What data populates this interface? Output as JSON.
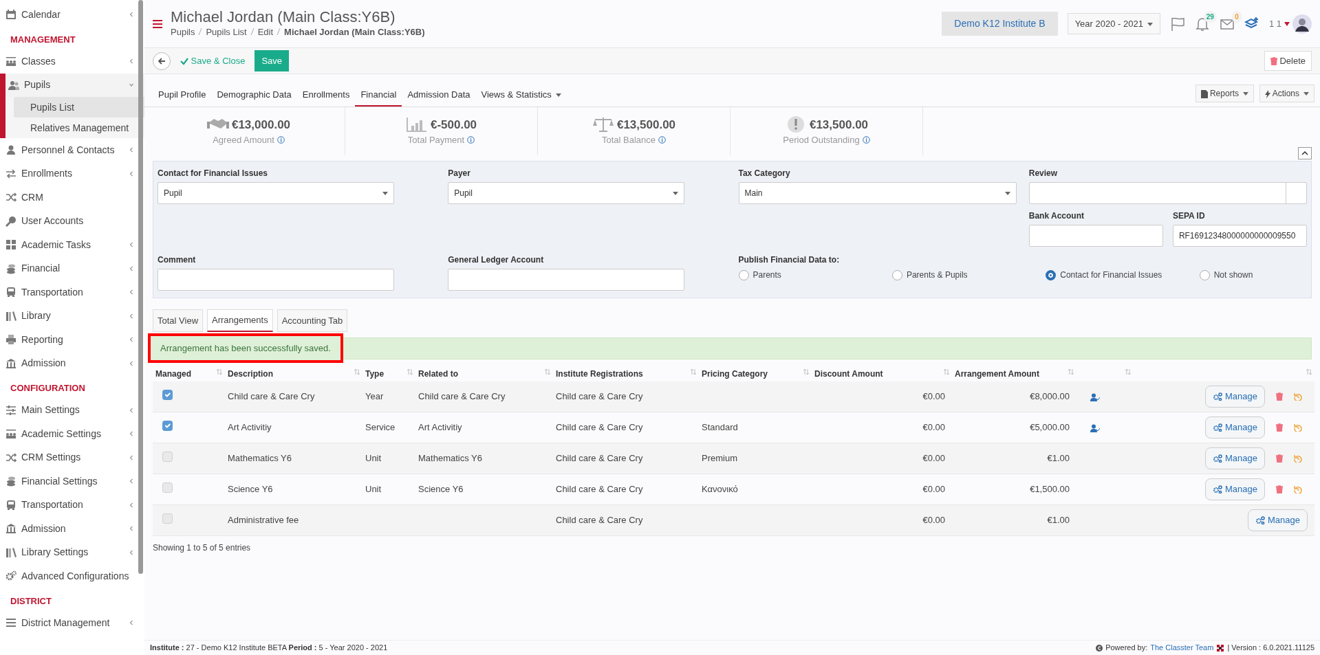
{
  "sidebar": {
    "sections": [
      {
        "items": [
          {
            "label": "Calendar",
            "expanded": false,
            "selected": false
          }
        ]
      },
      {
        "header": "MANAGEMENT",
        "items": [
          {
            "label": "Classes",
            "expanded": false,
            "selected": false
          },
          {
            "label": "Pupils",
            "expanded": true,
            "selected": true,
            "children": [
              {
                "label": "Pupils List",
                "selected": true
              },
              {
                "label": "Relatives Management",
                "selected": false
              }
            ]
          },
          {
            "label": "Personnel & Contacts",
            "expanded": false,
            "selected": false
          },
          {
            "label": "Enrollments",
            "expanded": false,
            "selected": false
          },
          {
            "label": "CRM",
            "selected": false
          },
          {
            "label": "User Accounts",
            "selected": false
          },
          {
            "label": "Academic Tasks",
            "expanded": false,
            "selected": false
          },
          {
            "label": "Financial",
            "expanded": false,
            "selected": false
          },
          {
            "label": "Transportation",
            "expanded": false,
            "selected": false
          },
          {
            "label": "Library",
            "expanded": false,
            "selected": false
          },
          {
            "label": "Reporting",
            "expanded": false,
            "selected": false
          },
          {
            "label": "Admission",
            "expanded": false,
            "selected": false
          }
        ]
      },
      {
        "header": "CONFIGURATION",
        "items": [
          {
            "label": "Main Settings",
            "expanded": false,
            "selected": false
          },
          {
            "label": "Academic Settings",
            "expanded": false,
            "selected": false
          },
          {
            "label": "CRM Settings",
            "expanded": false,
            "selected": false
          },
          {
            "label": "Financial Settings",
            "expanded": false,
            "selected": false
          },
          {
            "label": "Transportation",
            "expanded": false,
            "selected": false
          },
          {
            "label": "Admission",
            "expanded": false,
            "selected": false
          },
          {
            "label": "Library Settings",
            "expanded": false,
            "selected": false
          },
          {
            "label": "Advanced Configurations",
            "selected": false
          }
        ]
      },
      {
        "header": "DISTRICT",
        "items": [
          {
            "label": "District Management",
            "expanded": false,
            "selected": false
          }
        ]
      }
    ]
  },
  "header": {
    "title": "Michael Jordan (Main Class:Y6B)",
    "breadcrumbs": [
      "Pupils",
      "Pupils List",
      "Edit",
      "Michael Jordan (Main Class:Y6B)"
    ],
    "institute": "Demo K12 Institute B",
    "year": "Year 2020 - 2021",
    "notifications": "29",
    "messages": "0",
    "user": "1 1"
  },
  "toolbar": {
    "save_close": "Save & Close",
    "save": "Save",
    "delete": "Delete"
  },
  "tabs": [
    {
      "label": "Pupil Profile",
      "selected": false
    },
    {
      "label": "Demographic Data",
      "selected": false
    },
    {
      "label": "Enrollments",
      "selected": false
    },
    {
      "label": "Financial",
      "selected": true
    },
    {
      "label": "Admission Data",
      "selected": false
    },
    {
      "label": "Views & Statistics",
      "selected": false,
      "dropdown": true
    }
  ],
  "tab_actions": [
    "Reports",
    "Actions"
  ],
  "summary": [
    {
      "amount": "€13,000.00",
      "label": "Agreed Amount"
    },
    {
      "amount": "€-500.00",
      "label": "Total Payment"
    },
    {
      "amount": "€13,500.00",
      "label": "Total Balance"
    },
    {
      "amount": "€13,500.00",
      "label": "Period Outstanding"
    }
  ],
  "form": {
    "contact": {
      "label": "Contact for Financial Issues",
      "value": "Pupil"
    },
    "payer": {
      "label": "Payer",
      "value": "Pupil"
    },
    "tax_category": {
      "label": "Tax Category",
      "value": "Main"
    },
    "review": {
      "label": "Review"
    },
    "bank_account": {
      "label": "Bank Account"
    },
    "sepa_id": {
      "label": "SEPA ID",
      "value": "RF16912348000000000009550"
    },
    "comment": {
      "label": "Comment"
    },
    "ledger": {
      "label": "General Ledger Account"
    },
    "publish": {
      "label": "Publish Financial Data to:",
      "options": [
        {
          "label": "Parents",
          "selected": false
        },
        {
          "label": "Parents & Pupils",
          "selected": false
        },
        {
          "label": "Contact for Financial Issues",
          "selected": true
        },
        {
          "label": "Not shown",
          "selected": false
        }
      ]
    }
  },
  "subtabs": [
    {
      "label": "Total View",
      "selected": false
    },
    {
      "label": "Arrangements",
      "selected": true
    },
    {
      "label": "Accounting Tab",
      "selected": false
    }
  ],
  "alert": "Arrangement has been successfully saved.",
  "table": {
    "columns": [
      "Managed",
      "Description",
      "Type",
      "Related to",
      "Institute Registrations",
      "Pricing Category",
      "Discount Amount",
      "Arrangement Amount"
    ],
    "rows": [
      {
        "checked": true,
        "disabled": false,
        "description": "Child care & Care Cry",
        "type": "Year",
        "related_to": "Child care & Care Cry",
        "registrations": "Child care & Care Cry",
        "discount": "€0.00",
        "amount": "€8,000.00",
        "manage": "Manage",
        "deletable": true
      },
      {
        "checked": true,
        "disabled": false,
        "description": "Art Activitiy",
        "type": "Service",
        "related_to": "Art Activitiy",
        "registrations": "Child care & Care Cry",
        "pricing": "Standard",
        "discount": "€0.00",
        "amount": "€5,000.00",
        "manage": "Manage",
        "deletable": true
      },
      {
        "checked": false,
        "disabled": true,
        "description": "Mathematics Y6",
        "type": "Unit",
        "related_to": "Mathematics Y6",
        "registrations": "Child care & Care Cry",
        "pricing": "Premium",
        "discount": "€0.00",
        "amount": "€1.00",
        "manage": "Manage",
        "deletable": true
      },
      {
        "checked": false,
        "disabled": true,
        "description": "Science Y6",
        "type": "Unit",
        "related_to": "Science Y6",
        "registrations": "Child care & Care Cry",
        "pricing": "Κανονικό",
        "discount": "€0.00",
        "amount": "€1,500.00",
        "manage": "Manage",
        "deletable": true
      },
      {
        "checked": false,
        "disabled": true,
        "description": "Administrative fee",
        "registrations": "Child care & Care Cry",
        "discount": "€0.00",
        "amount": "€1.00",
        "manage": "Manage",
        "deletable": false
      }
    ],
    "info": "Showing 1 to 5 of 5 entries"
  },
  "footer": {
    "left": "**Institute :** 27 - Demo K12 Institute BETA **Period :** 5 - Year 2020 - 2021",
    "powered": "Powered by:",
    "team": "The Classter Team",
    "version": "| Version : 6.0.2021.11125"
  }
}
